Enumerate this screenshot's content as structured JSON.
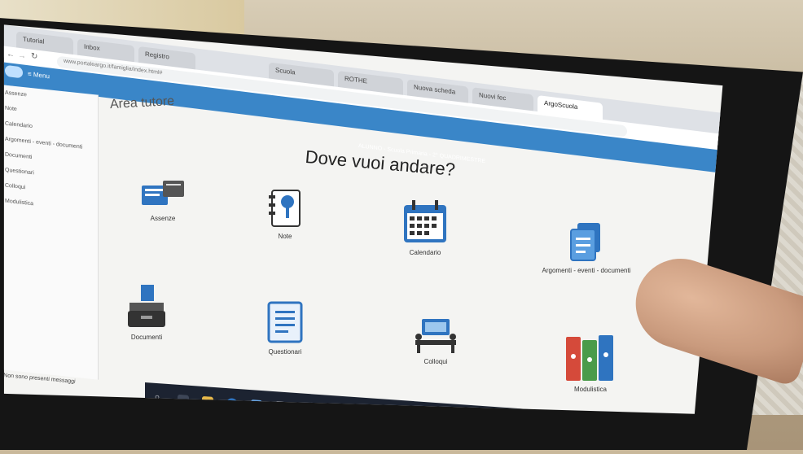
{
  "browser": {
    "tabs": [
      {
        "label": "Tutorial",
        "active": false
      },
      {
        "label": "Inbox",
        "active": false
      },
      {
        "label": "Registro",
        "active": false
      },
      {
        "label": "Scuola",
        "active": false
      },
      {
        "label": "ROTHE",
        "active": false
      },
      {
        "label": "Nuova scheda",
        "active": false
      },
      {
        "label": "Nuovi fec",
        "active": false
      },
      {
        "label": "ArgoScuola",
        "active": true
      }
    ],
    "url": "www.portaleargo.it/famiglia/index.html#"
  },
  "app": {
    "menu_label": "≡ Menu",
    "user_info": "ALUNNO - Scuola Primaria - 2° QUADRIMESTRE",
    "area_title": "Area tutore",
    "main_title": "Dove vuoi andare?",
    "sidebar": [
      "Assenze",
      "Note",
      "Calendario",
      "Argomenti - eventi - documenti",
      "Documenti",
      "Questionari",
      "Colloqui",
      "Modulistica"
    ],
    "status_text": "Non sono presenti messaggi",
    "tiles": [
      {
        "label": "Assenze",
        "icon": "absence-icon"
      },
      {
        "label": "Note",
        "icon": "notebook-pin-icon"
      },
      {
        "label": "Calendario",
        "icon": "calendar-icon"
      },
      {
        "label": "Argomenti - eventi - documenti",
        "icon": "documents-icon"
      },
      {
        "label": "Documenti",
        "icon": "inbox-tray-icon"
      },
      {
        "label": "Questionari",
        "icon": "questionnaire-icon"
      },
      {
        "label": "Colloqui",
        "icon": "meeting-icon"
      },
      {
        "label": "Modulistica",
        "icon": "binders-icon"
      }
    ]
  },
  "colors": {
    "header": "#3a86c8",
    "taskbar": "#1c2331",
    "tile_icon_blue": "#2f74c0",
    "tile_icon_red": "#d54a3a",
    "tile_icon_green": "#4a9b4a"
  }
}
